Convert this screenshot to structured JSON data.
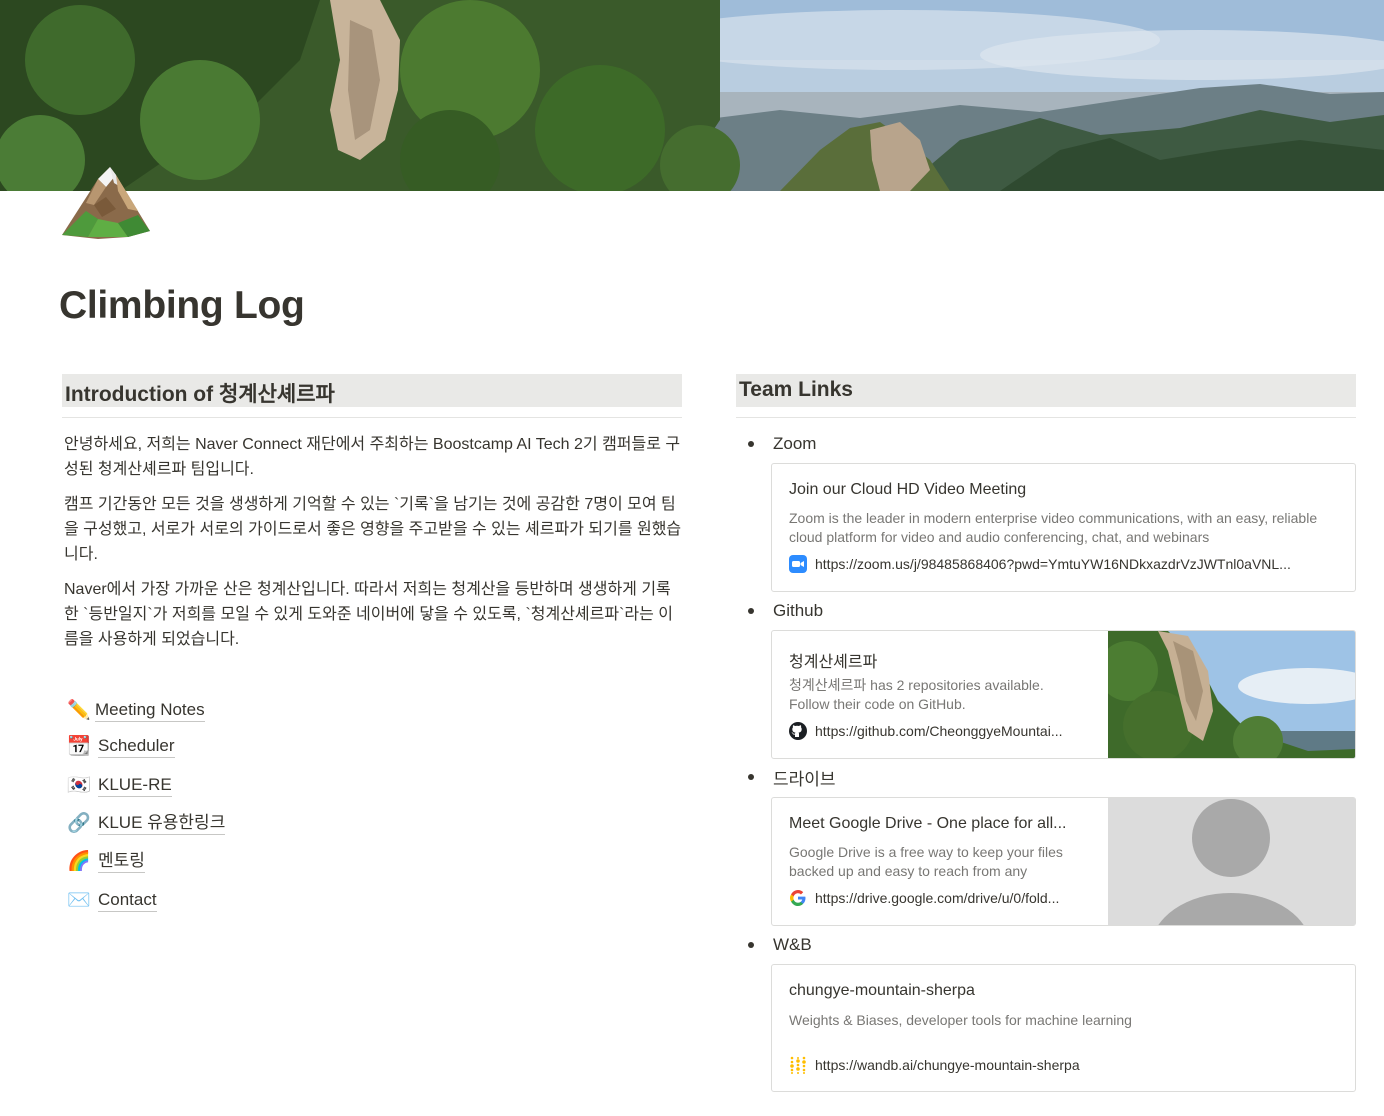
{
  "page": {
    "title": "Climbing Log",
    "icon": "mountain-icon"
  },
  "intro": {
    "heading": "Introduction of 청계산셰르파",
    "paragraphs": [
      "안녕하세요, 저희는 Naver Connect 재단에서 주최하는 Boostcamp AI Tech 2기 캠퍼들로 구성된 청계산셰르파 팀입니다.",
      "캠프 기간동안 모든 것을 생생하게 기억할 수 있는 `기록`을 남기는 것에 공감한 7명이 모여 팀을 구성했고, 서로가 서로의 가이드로서 좋은 영향을 주고받을 수 있는 셰르파가 되기를 원했습니다.",
      "Naver에서 가장 가까운 산은 청계산입니다. 따라서 저희는 청계산을 등반하며 생생하게 기록한 `등반일지`가 저희를 모일 수 있게 도와준 네이버에 닿을 수 있도록, `청계산셰르파`라는 이름을 사용하게 되었습니다."
    ]
  },
  "nav_links": [
    {
      "label": "Meeting Notes",
      "icon": "pencil-icon",
      "glyph": "✏️"
    },
    {
      "label": "Scheduler",
      "icon": "calendar-icon",
      "glyph": "📆"
    },
    {
      "label": "KLUE-RE",
      "icon": "korea-flag-icon",
      "glyph": "🇰🇷"
    },
    {
      "label": "KLUE 유용한링크",
      "icon": "link-icon",
      "glyph": "🔗"
    },
    {
      "label": "멘토링",
      "icon": "rainbow-icon",
      "glyph": "🌈"
    },
    {
      "label": "Contact",
      "icon": "envelope-icon",
      "glyph": "✉️"
    }
  ],
  "team_links": {
    "heading": "Team Links",
    "items": [
      {
        "label": "Zoom",
        "bookmark": {
          "title": "Join our Cloud HD Video Meeting",
          "description": "Zoom is the leader in modern enterprise video communications, with an easy, reliable cloud platform for video and audio conferencing, chat, and webinars",
          "url": "https://zoom.us/j/98485868406?pwd=YmtuYW16NDkxazdrVzJWTnl0aVNL...",
          "favicon": "zoom-icon"
        }
      },
      {
        "label": "Github",
        "bookmark": {
          "title": "청계산셰르파",
          "description": "청계산셰르파 has 2 repositories available. Follow their code on GitHub.",
          "url": "https://github.com/CheonggyeMountai...",
          "favicon": "github-icon"
        }
      },
      {
        "label": "드라이브",
        "bookmark": {
          "title": "Meet Google Drive - One place for all...",
          "description": "Google Drive is a free way to keep your files backed up and easy to reach from any",
          "url": "https://drive.google.com/drive/u/0/fold...",
          "favicon": "google-icon"
        }
      },
      {
        "label": "W&B",
        "bookmark": {
          "title": "chungye-mountain-sherpa",
          "description": "Weights & Biases, developer tools for machine learning",
          "url": "https://wandb.ai/chungye-mountain-sherpa",
          "favicon": "wandb-icon"
        }
      }
    ]
  },
  "colors": {
    "text": "#37352f",
    "muted": "#787774",
    "heading_bg": "#e9e9e7",
    "zoom_blue": "#2d8cff"
  }
}
